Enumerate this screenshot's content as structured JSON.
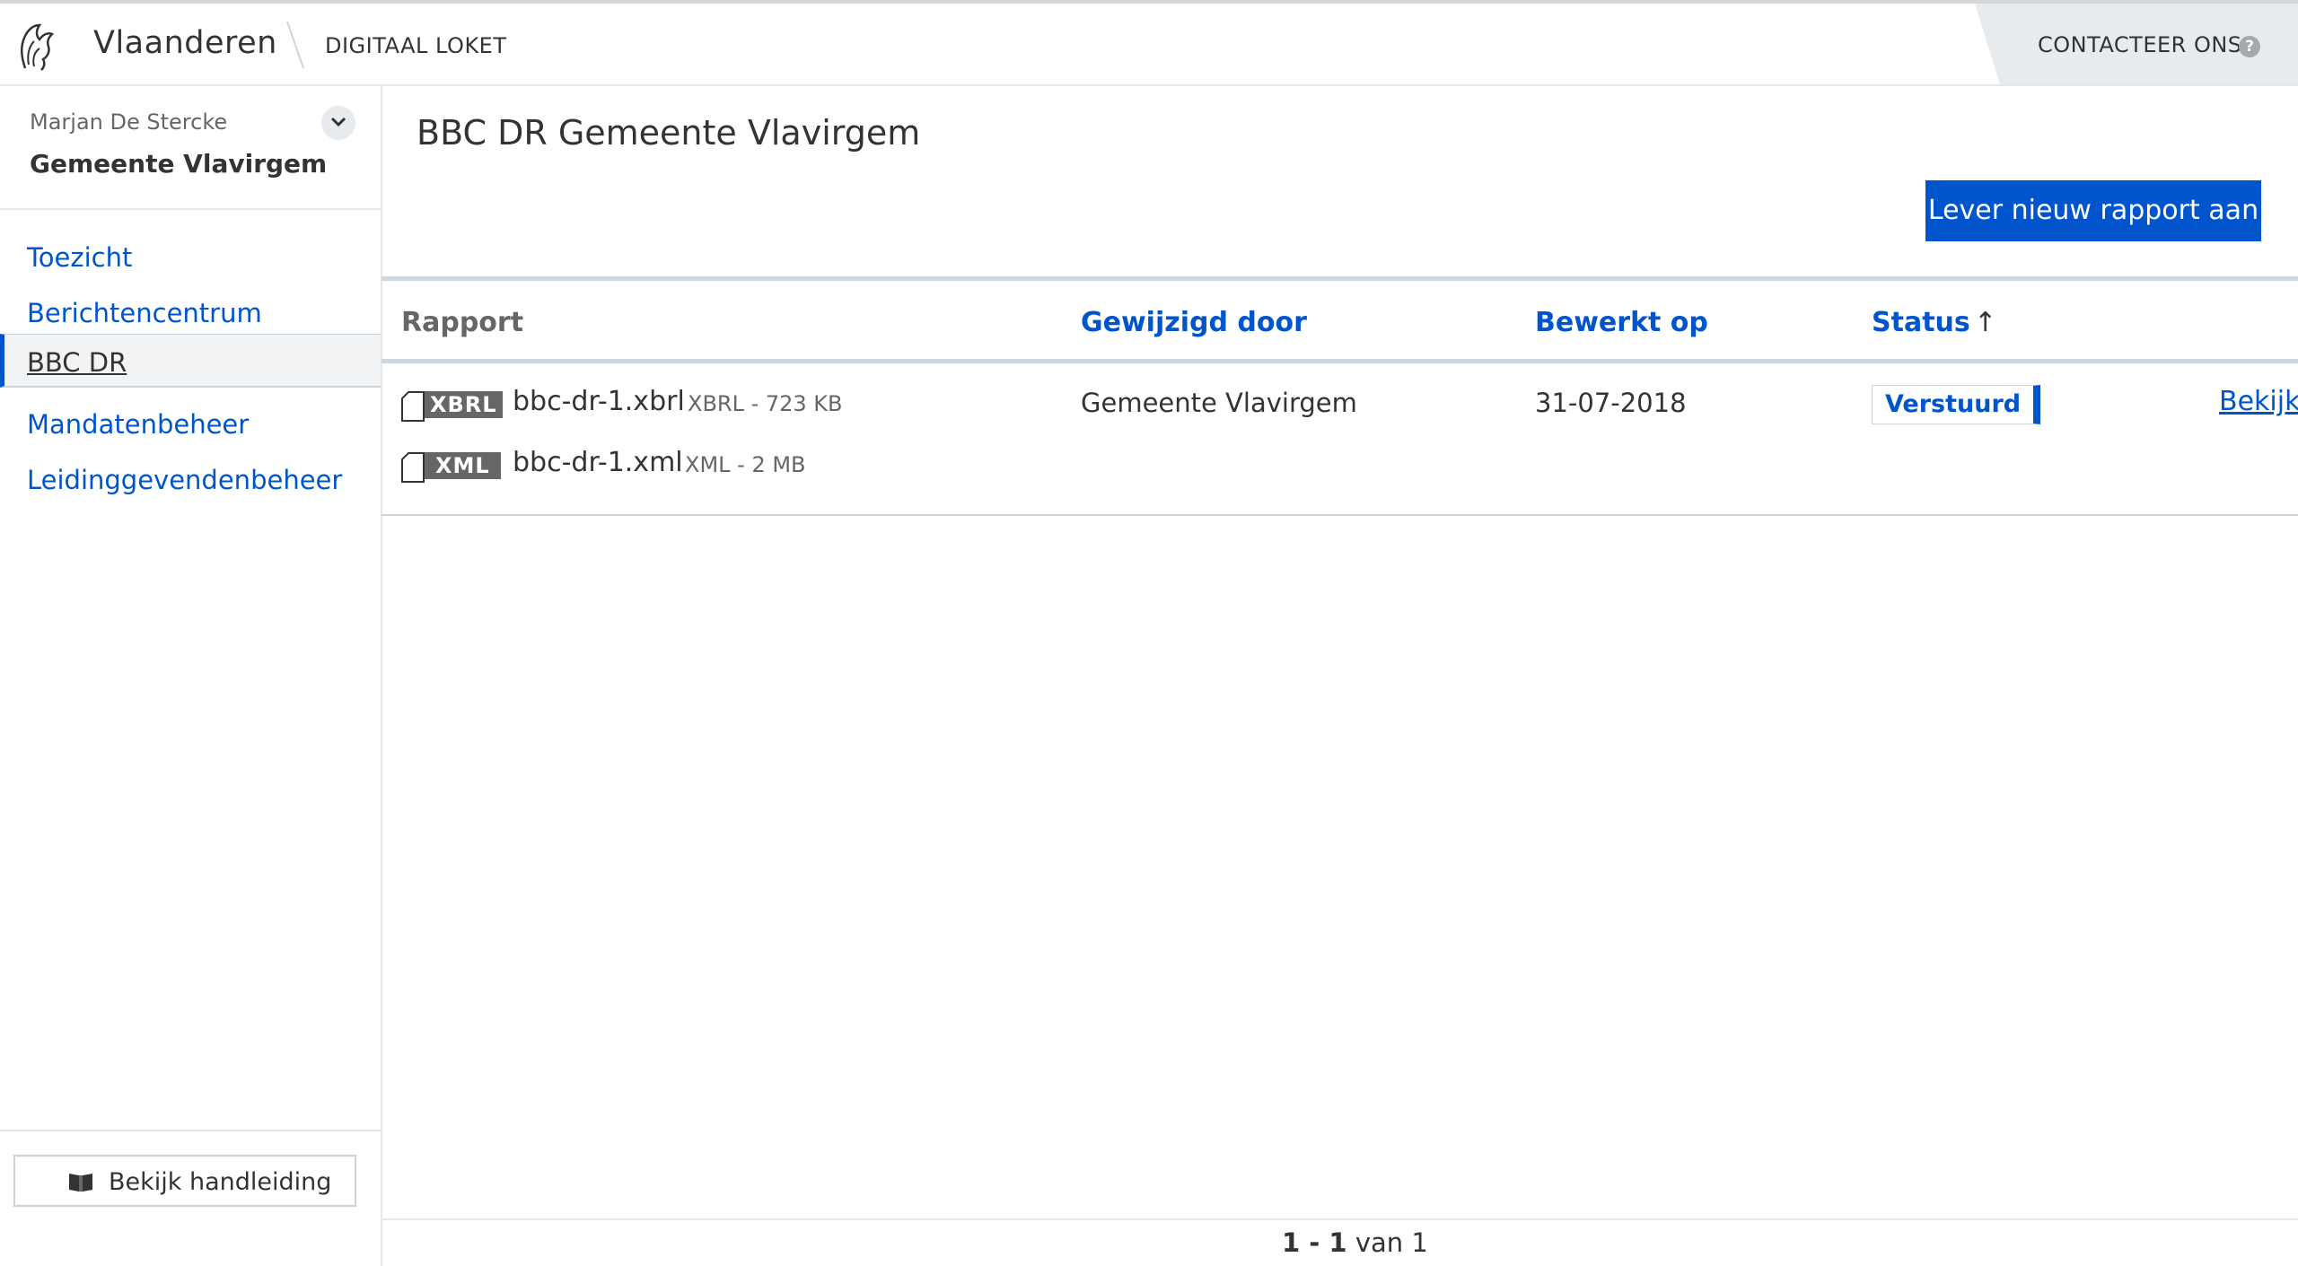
{
  "header": {
    "brand": "Vlaanderen",
    "app_name": "DIGITAAL LOKET",
    "contact_label": "CONTACTEER ONS",
    "help_glyph": "?"
  },
  "sidebar": {
    "user_name": "Marjan De Stercke",
    "organization": "Gemeente Vlavirgem",
    "nav": [
      {
        "label": "Toezicht",
        "active": false
      },
      {
        "label": "Berichtencentrum",
        "active": false
      },
      {
        "label": "BBC DR",
        "active": true
      },
      {
        "label": "Mandatenbeheer",
        "active": false
      },
      {
        "label": "Leidinggevendenbeheer",
        "active": false
      }
    ],
    "manual_button": "Bekijk handleiding"
  },
  "main": {
    "title": "BBC DR Gemeente Vlavirgem",
    "primary_button": "Lever nieuw rapport aan",
    "table": {
      "columns": [
        "Rapport",
        "Gewijzigd door",
        "Bewerkt op",
        "Status"
      ],
      "sort_indicator": "↑",
      "rows": [
        {
          "files": [
            {
              "type": "XBRL",
              "name": "bbc-dr-1.xbrl",
              "meta": "XBRL - 723 KB"
            },
            {
              "type": "XML",
              "name": "bbc-dr-1.xml",
              "meta": "XML - 2 MB"
            }
          ],
          "modified_by": "Gemeente Vlavirgem",
          "edited_on": "31-07-2018",
          "status": "Verstuurd",
          "action": "Bekijk"
        }
      ]
    },
    "pagination": {
      "range": "1 - 1",
      "of_label": "van",
      "total": "1"
    }
  },
  "colors": {
    "accent": "#0055cc",
    "text": "#333332",
    "muted": "#666666",
    "border": "#cfd5dd"
  }
}
